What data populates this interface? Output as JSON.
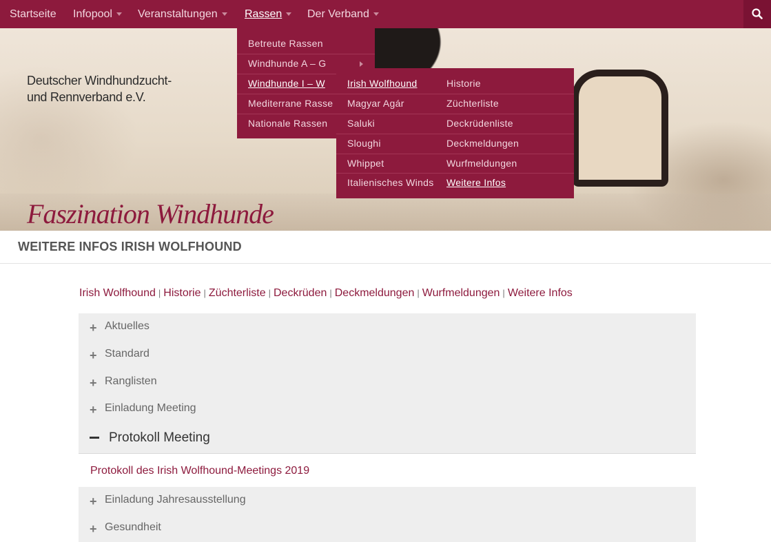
{
  "nav": {
    "items": [
      {
        "label": "Startseite",
        "caret": false
      },
      {
        "label": "Infopool",
        "caret": true
      },
      {
        "label": "Veranstaltungen",
        "caret": true
      },
      {
        "label": "Rassen",
        "caret": true
      },
      {
        "label": "Der Verband",
        "caret": true
      }
    ],
    "search_icon": "search-icon"
  },
  "hero": {
    "org_line1": "Deutscher Windhundzucht-",
    "org_line2": "und Rennverband e.V.",
    "tagline": "Faszination Windhunde"
  },
  "dropdown_rassen": [
    "Betreute Rassen",
    "Windhunde A – G",
    "Windhunde I – W",
    "Mediterrane Rasse",
    "Nationale Rassen"
  ],
  "dropdown_breeds": [
    "Irish Wolfhound",
    "Magyar Agár",
    "Saluki",
    "Sloughi",
    "Whippet",
    "Italienisches Winds"
  ],
  "dropdown_subpages": [
    "Historie",
    "Züchterliste",
    "Deckrüdenliste",
    "Deckmeldungen",
    "Wurfmeldungen",
    "Weitere Infos"
  ],
  "page": {
    "title": "WEITERE INFOS IRISH WOLFHOUND",
    "sublinks": [
      "Irish Wolfhound",
      "Historie",
      "Züchterliste",
      "Deckrüden",
      "Deckmeldungen",
      "Wurfmeldungen",
      "Weitere Infos"
    ],
    "separator": "|"
  },
  "accordion": {
    "items": [
      "Aktuelles",
      "Standard",
      "Ranglisten",
      "Einladung Meeting",
      "Protokoll Meeting",
      "Einladung Jahresausstellung",
      "Gesundheit"
    ],
    "open_link": "Protokoll des Irish Wolfhound-Meetings 2019"
  },
  "colors": {
    "brand": "#8d1a3d",
    "accordion_bg": "#eeeeee"
  }
}
